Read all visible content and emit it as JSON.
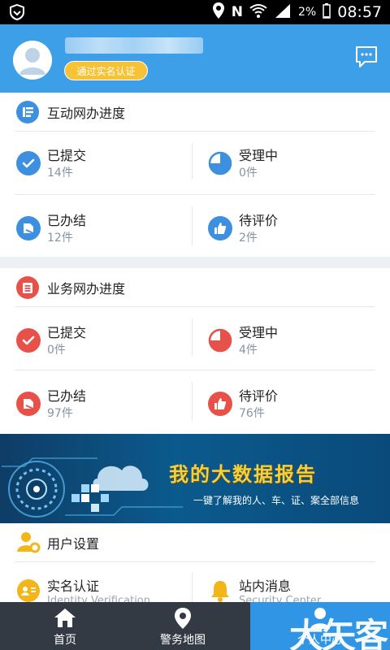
{
  "status_bar": {
    "battery": "2%",
    "time": "08:57"
  },
  "header": {
    "username": "████████████",
    "verify_badge": "通过实名认证"
  },
  "interactive_progress": {
    "title": "互动网办进度",
    "items": [
      {
        "label": "已提交",
        "count": "14件",
        "icon": "check-icon"
      },
      {
        "label": "受理中",
        "count": "0件",
        "icon": "pie-icon"
      },
      {
        "label": "已办结",
        "count": "12件",
        "icon": "done-icon"
      },
      {
        "label": "待评价",
        "count": "2件",
        "icon": "thumbs-up-icon"
      }
    ],
    "color": "#3d8fe0"
  },
  "business_progress": {
    "title": "业务网办进度",
    "items": [
      {
        "label": "已提交",
        "count": "0件",
        "icon": "check-icon"
      },
      {
        "label": "受理中",
        "count": "4件",
        "icon": "pie-icon"
      },
      {
        "label": "已办结",
        "count": "97件",
        "icon": "done-icon"
      },
      {
        "label": "待评价",
        "count": "76件",
        "icon": "thumbs-up-icon"
      }
    ],
    "color": "#e8514a"
  },
  "banner": {
    "title": "我的大数据报告",
    "subtitle": "一键了解我的人、车、证、案全部信息"
  },
  "user_settings": {
    "title": "用户设置",
    "items": [
      {
        "label": "实名认证",
        "sub": "Identity Verification"
      },
      {
        "label": "站内消息",
        "sub": "Security Center"
      }
    ]
  },
  "bottom_nav": {
    "tabs": [
      {
        "label": "首页"
      },
      {
        "label": "警务地图"
      },
      {
        "label": "个人中心"
      }
    ],
    "watermark": "大矢客"
  }
}
